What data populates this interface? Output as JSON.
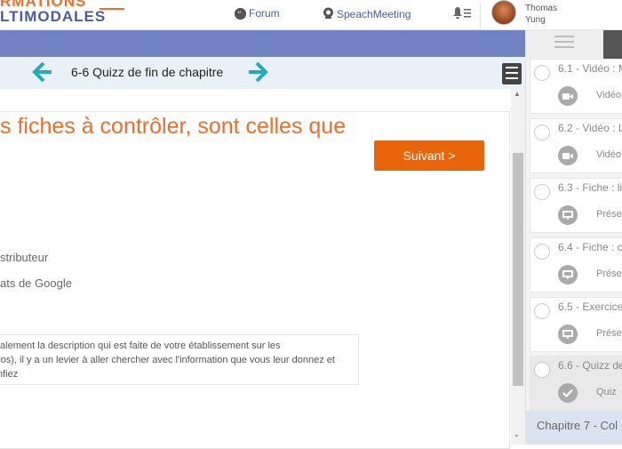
{
  "header": {
    "logo_line1": "RMATIONS",
    "logo_line2": "LTIMODALES",
    "forum_label": "Forum",
    "speach_label": "SpeachMeeting",
    "user_first": "Thomas",
    "user_last": "Yung"
  },
  "lesson": {
    "title": "6-6 Quizz de fin de chapitre",
    "question": "s fiches à contrôler, sont celles que",
    "next_label": "Suivant >",
    "answers": [
      "stributeur",
      "ats de Google"
    ],
    "explanation": [
      "talement la description qui est faite de votre établissement sur les",
      "ros), il y a un levier à aller chercher avec l'information que vous leur donnez et",
      "nfiez"
    ]
  },
  "sidebar": {
    "items": [
      {
        "title": "6.1 - Vidéo : M",
        "sub": "Vidéo",
        "icon": "video-icon"
      },
      {
        "title": "6.2 - Vidéo : L",
        "sub": "Vidéo",
        "icon": "video-icon"
      },
      {
        "title": "6.3 - Fiche : li",
        "sub": "Présen",
        "icon": "presentation-icon"
      },
      {
        "title": "6.4 - Fiche : c",
        "sub": "Présen",
        "icon": "presentation-icon"
      },
      {
        "title": "6.5 - Exercice",
        "sub": "Présen",
        "icon": "presentation-icon"
      },
      {
        "title": "6.6 - Quizz de",
        "sub": "Quiz",
        "icon": "check-icon"
      }
    ],
    "chapter_label": "Chapitre 7 - Col"
  },
  "colors": {
    "accent_orange": "#e8650c",
    "brand_blue": "#7283c4",
    "arrow_teal": "#26a9b8"
  }
}
